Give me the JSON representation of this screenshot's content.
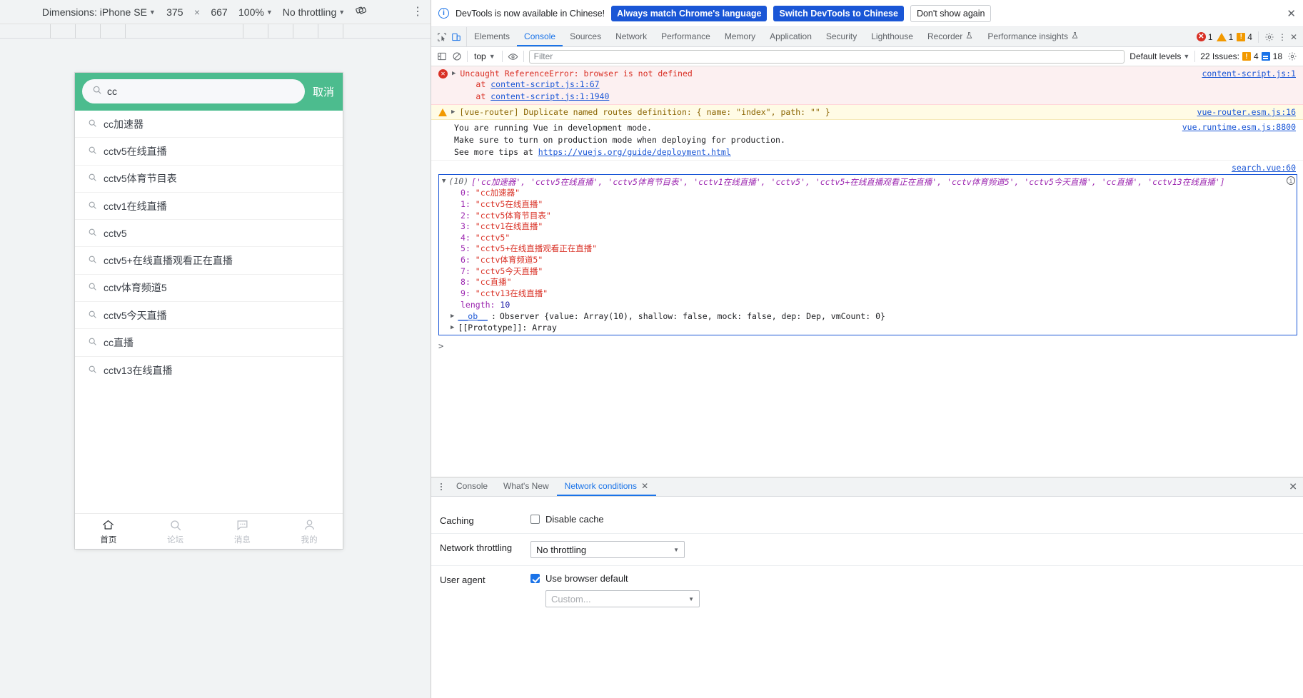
{
  "device_toolbar": {
    "dimensions_label": "Dimensions: iPhone SE",
    "width": "375",
    "times": "×",
    "height": "667",
    "zoom": "100%",
    "throttling": "No throttling",
    "rotate_icon": "rotate-icon",
    "more_icon": "kebab-menu-icon"
  },
  "mobile": {
    "search": {
      "value": "cc",
      "placeholder": "",
      "cancel_label": "取消",
      "icon": "search-icon"
    },
    "suggestions": [
      "cc加速器",
      "cctv5在线直播",
      "cctv5体育节目表",
      "cctv1在线直播",
      "cctv5",
      "cctv5+在线直播观看正在直播",
      "cctv体育频道5",
      "cctv5今天直播",
      "cc直播",
      "cctv13在线直播"
    ],
    "tabbar": [
      {
        "label": "首页",
        "icon": "home-icon",
        "active": true
      },
      {
        "label": "论坛",
        "icon": "search-icon",
        "active": false
      },
      {
        "label": "消息",
        "icon": "message-icon",
        "active": false
      },
      {
        "label": "我的",
        "icon": "person-icon",
        "active": false
      }
    ],
    "accent_color": "#4cbc8e"
  },
  "infobar": {
    "icon": "info-icon",
    "message": "DevTools is now available in Chinese!",
    "btn_always": "Always match Chrome's language",
    "btn_switch": "Switch DevTools to Chinese",
    "btn_dismiss": "Don't show again",
    "close_icon": "close-icon"
  },
  "tabstrip": {
    "inspect_icon": "inspect-element-icon",
    "device_icon": "device-toolbar-icon",
    "tabs": [
      {
        "label": "Elements",
        "active": false,
        "experimental": false
      },
      {
        "label": "Console",
        "active": true,
        "experimental": false
      },
      {
        "label": "Sources",
        "active": false,
        "experimental": false
      },
      {
        "label": "Network",
        "active": false,
        "experimental": false
      },
      {
        "label": "Performance",
        "active": false,
        "experimental": false
      },
      {
        "label": "Memory",
        "active": false,
        "experimental": false
      },
      {
        "label": "Application",
        "active": false,
        "experimental": false
      },
      {
        "label": "Security",
        "active": false,
        "experimental": false
      },
      {
        "label": "Lighthouse",
        "active": false,
        "experimental": false
      },
      {
        "label": "Recorder",
        "active": false,
        "experimental": true
      },
      {
        "label": "Performance insights",
        "active": false,
        "experimental": true
      }
    ],
    "error_count": "1",
    "warning_count": "1",
    "info_count": "4",
    "settings_icon": "gear-icon",
    "more_icon": "kebab-menu-icon",
    "close_icon": "close-icon"
  },
  "console_toolbar": {
    "sidebar_icon": "console-sidebar-icon",
    "clear_icon": "clear-console-icon",
    "context": "top",
    "eye_icon": "live-expression-icon",
    "filter_placeholder": "Filter",
    "filter_value": "",
    "levels": "Default levels",
    "issues_text": "22 Issues:",
    "issues_orange": "4",
    "issues_blue": "18",
    "settings_icon": "gear-icon"
  },
  "console": {
    "error": {
      "text": "Uncaught ReferenceError: browser is not defined",
      "stack": [
        {
          "at": "at",
          "link": "content-script.js:1:67"
        },
        {
          "at": "at",
          "link": "content-script.js:1:1940"
        }
      ],
      "source": "content-script.js:1"
    },
    "warning": {
      "text": "[vue-router] Duplicate named routes definition: { name: \"index\", path: \"\" }",
      "source": "vue-router.esm.js:16"
    },
    "vue_notice": {
      "line1": "You are running Vue in development mode.",
      "line2": "Make sure to turn on production mode when deploying for production.",
      "line3_prefix": "See more tips at ",
      "line3_link": "https://vuejs.org/guide/deployment.html",
      "source": "vue.runtime.esm.js:8800"
    },
    "array_log": {
      "count": "(10)",
      "preview": "['cc加速器', 'cctv5在线直播', 'cctv5体育节目表', 'cctv1在线直播', 'cctv5', 'cctv5+在线直播观看正在直播', 'cctv体育频道5', 'cctv5今天直播', 'cc直播', 'cctv13在线直播']",
      "items": [
        {
          "index": "0",
          "value": "\"cc加速器\""
        },
        {
          "index": "1",
          "value": "\"cctv5在线直播\""
        },
        {
          "index": "2",
          "value": "\"cctv5体育节目表\""
        },
        {
          "index": "3",
          "value": "\"cctv1在线直播\""
        },
        {
          "index": "4",
          "value": "\"cctv5\""
        },
        {
          "index": "5",
          "value": "\"cctv5+在线直播观看正在直播\""
        },
        {
          "index": "6",
          "value": "\"cctv体育频道5\""
        },
        {
          "index": "7",
          "value": "\"cctv5今天直播\""
        },
        {
          "index": "8",
          "value": "\"cc直播\""
        },
        {
          "index": "9",
          "value": "\"cctv13在线直播\""
        }
      ],
      "length_key": "length",
      "length_value": "10",
      "ob_key": "__ob__",
      "ob_value": "Observer {value: Array(10), shallow: false, mock: false, dep: Dep, vmCount: 0}",
      "prototype": "[[Prototype]]: Array",
      "source": "search.vue:60",
      "info_icon": "info-icon"
    },
    "prompt": ">"
  },
  "drawer": {
    "kebab_icon": "kebab-menu-icon",
    "tabs": [
      {
        "label": "Console",
        "active": false,
        "closable": false
      },
      {
        "label": "What's New",
        "active": false,
        "closable": false
      },
      {
        "label": "Network conditions",
        "active": true,
        "closable": true
      }
    ],
    "close_icon": "close-icon",
    "network_conditions": {
      "caching_label": "Caching",
      "disable_cache_label": "Disable cache",
      "disable_cache_checked": false,
      "throttling_label": "Network throttling",
      "throttling_value": "No throttling",
      "user_agent_label": "User agent",
      "use_browser_default_label": "Use browser default",
      "use_browser_default_checked": true,
      "custom_placeholder": "Custom..."
    }
  }
}
